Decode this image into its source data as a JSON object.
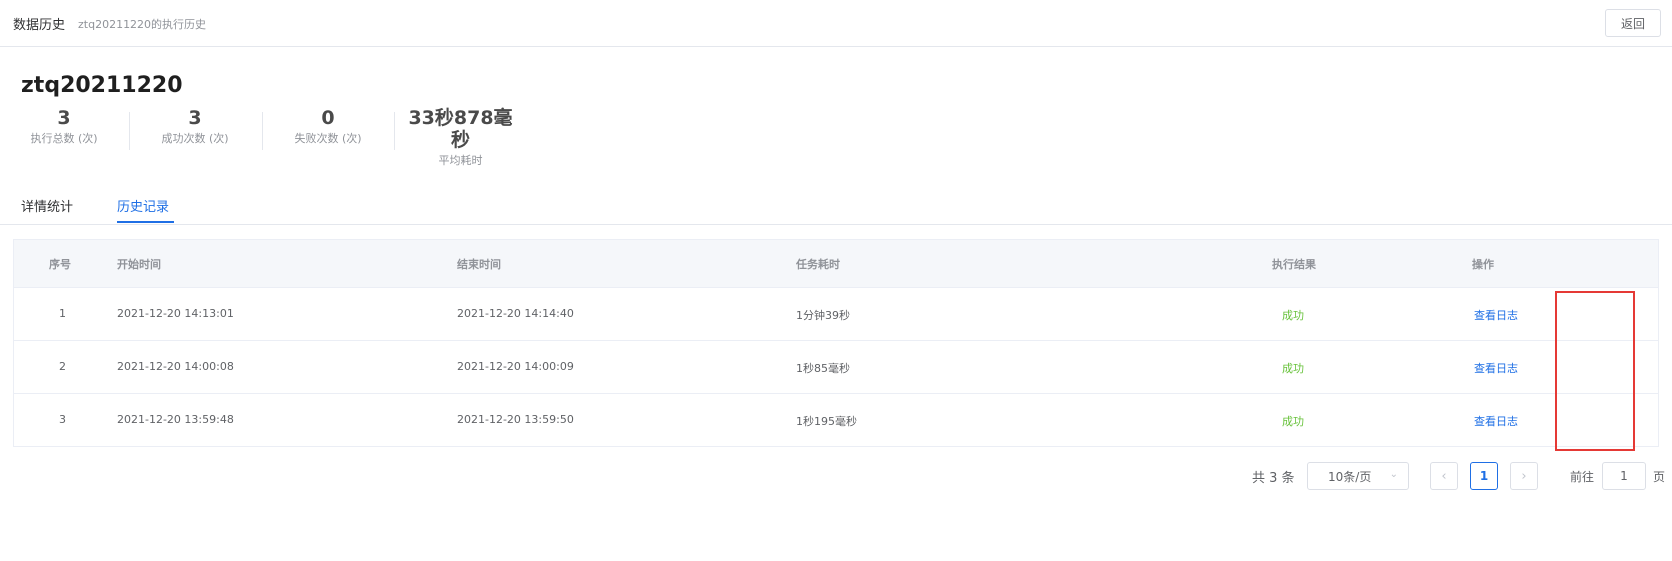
{
  "header": {
    "section": "数据历史",
    "subtitle": "ztq20211220的执行历史",
    "back_label": "返回"
  },
  "task": {
    "name": "ztq20211220",
    "stats": [
      {
        "value": "3",
        "label": "执行总数 (次)"
      },
      {
        "value": "3",
        "label": "成功次数 (次)"
      },
      {
        "value": "0",
        "label": "失败次数 (次)"
      },
      {
        "value": "33秒878毫秒",
        "label": "平均耗时"
      }
    ]
  },
  "tabs": [
    {
      "label": "详情统计",
      "active": false
    },
    {
      "label": "历史记录",
      "active": true
    }
  ],
  "table": {
    "columns": [
      "序号",
      "开始时间",
      "结束时间",
      "任务耗时",
      "执行结果",
      "操作"
    ],
    "rows": [
      {
        "index": "1",
        "start": "2021-12-20 14:13:01",
        "end": "2021-12-20 14:14:40",
        "duration": "1分钟39秒",
        "result": "成功",
        "action": "查看日志"
      },
      {
        "index": "2",
        "start": "2021-12-20 14:00:08",
        "end": "2021-12-20 14:00:09",
        "duration": "1秒85毫秒",
        "result": "成功",
        "action": "查看日志"
      },
      {
        "index": "3",
        "start": "2021-12-20 13:59:48",
        "end": "2021-12-20 13:59:50",
        "duration": "1秒195毫秒",
        "result": "成功",
        "action": "查看日志"
      }
    ]
  },
  "pagination": {
    "total": "共 3 条",
    "page_size": "10条/页",
    "current_page": "1",
    "goto_label": "前往",
    "goto_value": "1",
    "goto_unit": "页",
    "prev_icon": "chevron-left-icon",
    "next_icon": "chevron-right-icon"
  },
  "colors": {
    "primary": "#1f6fe5",
    "success": "#67c23a",
    "highlight": "#e53935"
  }
}
